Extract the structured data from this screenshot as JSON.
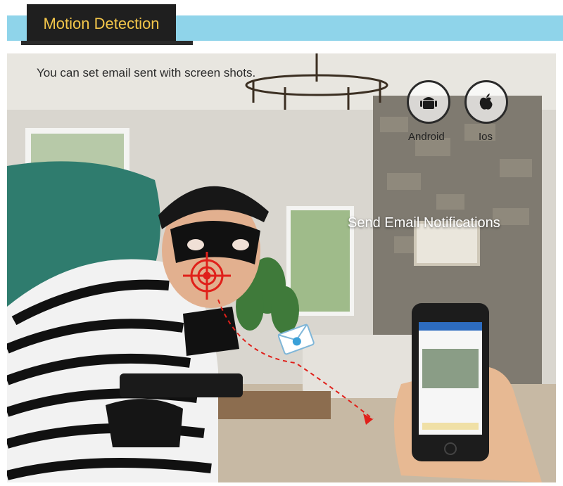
{
  "header": {
    "title": "Motion Detection"
  },
  "caption": "You can set email sent with screen shots.",
  "platforms": [
    {
      "label": "Android",
      "icon": "android-icon"
    },
    {
      "label": "Ios",
      "icon": "apple-icon"
    }
  ],
  "notification_label": "Send Email Notifications",
  "colors": {
    "header_band": "#8fd4ea",
    "header_tab": "#1f1f1f",
    "header_text": "#f3c64a",
    "target": "#e0201a"
  }
}
